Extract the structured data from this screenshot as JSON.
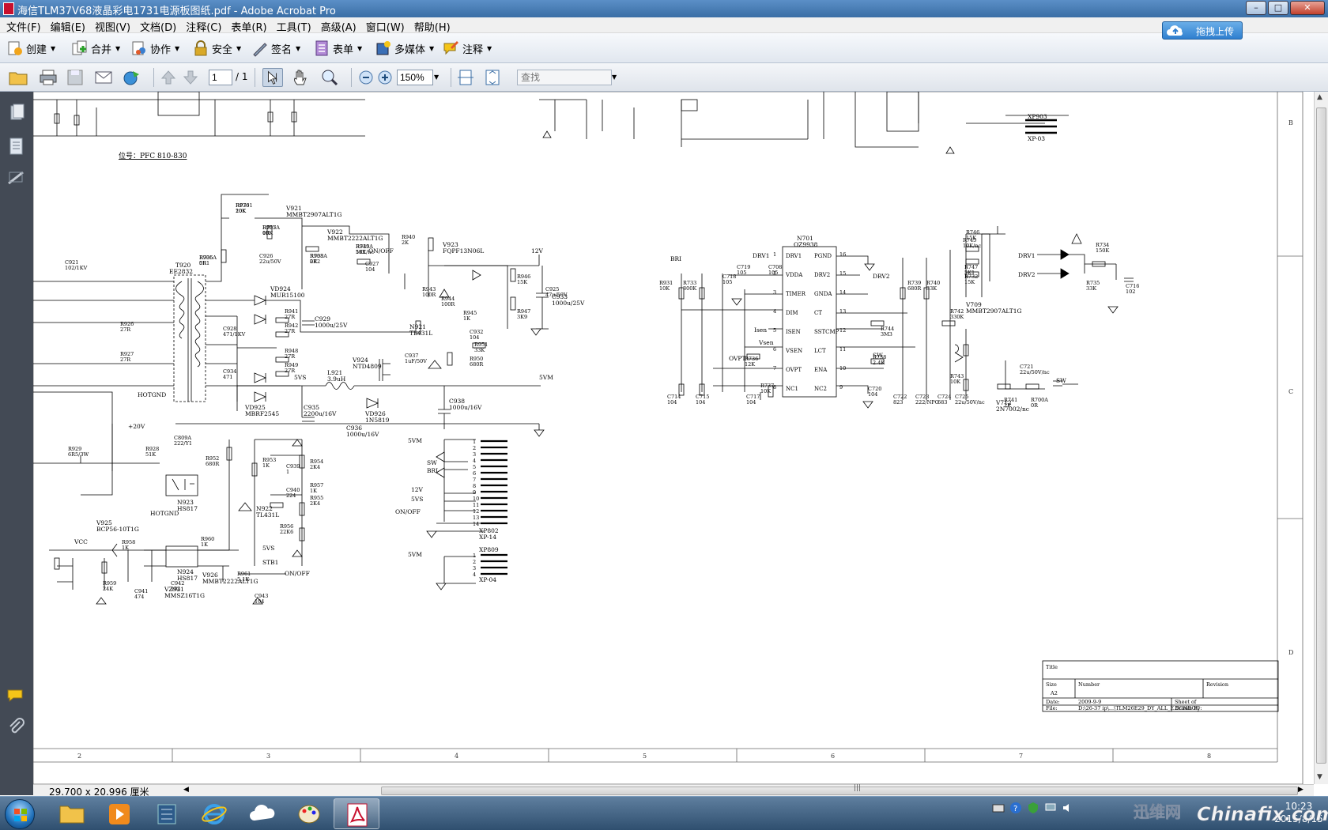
{
  "window": {
    "title": "海信TLM37V68液晶彩电1731电源板图纸.pdf - Adobe Acrobat Pro",
    "buttons": [
      "minimize",
      "maximize",
      "close"
    ]
  },
  "menu": [
    "文件(F)",
    "编辑(E)",
    "视图(V)",
    "文档(D)",
    "注释(C)",
    "表单(R)",
    "工具(T)",
    "高级(A)",
    "窗口(W)",
    "帮助(H)"
  ],
  "upload_button": "拖拽上传",
  "tasks": [
    {
      "label": "创建",
      "icon": "create-icon"
    },
    {
      "label": "合并",
      "icon": "combine-icon"
    },
    {
      "label": "协作",
      "icon": "collaborate-icon"
    },
    {
      "label": "安全",
      "icon": "lock-icon"
    },
    {
      "label": "签名",
      "icon": "pen-icon"
    },
    {
      "label": "表单",
      "icon": "form-icon"
    },
    {
      "label": "多媒体",
      "icon": "multimedia-icon"
    },
    {
      "label": "注释",
      "icon": "comment-icon"
    }
  ],
  "nav": {
    "page_current": "1",
    "page_total": "/ 1",
    "zoom": "150%",
    "find_placeholder": "查找"
  },
  "status": {
    "page_size": "29.700 x 20.996 厘米"
  },
  "clock": {
    "time": "10:23",
    "date": "2015/8/15"
  },
  "watermark": {
    "left": "迅维网",
    "right": "Chinafix.com"
  },
  "schematic": {
    "labels": {
      "position_note": "位号：PFC 810-830",
      "n701": "N701",
      "n701_part": "OZ9938",
      "t920": "T920",
      "t920_part": "EE2832",
      "v921": "V921",
      "v921_part": "MMBT2907ALT1G",
      "v922": "V922",
      "v922_part": "MMBT2222ALT1G",
      "v923": "V923",
      "v923_part": "FQPF13N06L",
      "vd924": "VD924",
      "vd924_part": "MUR15100",
      "vd925": "VD925",
      "vd925_part": "MBRF2545",
      "v924": "V924",
      "v924_part": "NTD4809",
      "vd926": "VD926",
      "vd926_part": "1N5819",
      "l921": "L921",
      "l921_val": "3.9uH",
      "c933": "C933",
      "c933_val": "1000u/25V",
      "c929": "C929",
      "c929_val": "1000u/25V",
      "c935": "C935",
      "c935_val": "2200u/16V",
      "c936": "C936",
      "c936_val": "1000u/16V",
      "c938": "C938",
      "c938_val": "1000u/16V",
      "v925": "V925",
      "v925_part": "BCP56-10T1G",
      "n923": "N923",
      "n923_part": "HS817",
      "n924": "N924",
      "n924_part": "HS817",
      "v926": "V926",
      "v926_part": "MMBT2222ALT1G",
      "vz921": "VZ921",
      "vz921_part": "MMSZ16T1G",
      "n922": "N922",
      "n922_part": "TL431L",
      "n921": "N921",
      "n921_part": "TL431L",
      "v709": "V709",
      "v709_part": "MMBT2907ALT1G",
      "v712": "V712",
      "v712_part": "2N7002/nc",
      "xp802": "XP802",
      "xp802_part": "XP-14",
      "xp809": "XP809",
      "xp809_part": "XP-04",
      "xp903": "XP903",
      "xp903_part": "XP-03",
      "net_12v": "12V",
      "net_5vm": "5VM",
      "net_5vs": "5VS",
      "net_stb1": "STB1",
      "net_onoff": "ON/OFF",
      "net_vcc": "VCC",
      "net_20v": "+20V",
      "net_hotgnd": "HOTGND",
      "net_bri": "BRI",
      "net_sw": "SW",
      "net_vsen": "Vsen",
      "net_isen": "Isen",
      "net_ovpt": "OVPT",
      "net_drv1": "DRV1",
      "net_drv2": "DRV2",
      "title_block_title": "Title",
      "title_block_size": "Size",
      "title_block_size_val": "A2",
      "title_block_number": "Number",
      "title_block_revision": "Revision",
      "title_block_date": "Date:",
      "title_block_date_val": "2009-9-9",
      "title_block_sheet": "Sheet   of",
      "title_block_file": "File:",
      "title_block_file_val": "D:\\26-37 ip\\...\\TLM26E29_DY_ALL_E.SCHDOC",
      "title_block_drawn": "Drawn By:"
    },
    "oz9938_pins_left": [
      "DRV1",
      "VDDA",
      "TIMER",
      "DIM",
      "ISEN",
      "VSEN",
      "OVPT",
      "NC1"
    ],
    "oz9938_pins_right": [
      "PGND",
      "DRV2",
      "GNDA",
      "CT",
      "SSTCMP",
      "LCT",
      "ENA",
      "NC2"
    ],
    "oz9938_pin_nums_left": [
      "1",
      "2",
      "3",
      "4",
      "5",
      "6",
      "7",
      "8"
    ],
    "oz9938_pin_nums_right": [
      "16",
      "15",
      "14",
      "13",
      "12",
      "11",
      "10",
      "9"
    ],
    "border_cols": [
      "2",
      "3",
      "4",
      "5",
      "6",
      "7",
      "8"
    ],
    "border_rows": [
      "B",
      "C",
      "D"
    ],
    "connector_pins_14": [
      "1",
      "2",
      "3",
      "4",
      "5",
      "6",
      "7",
      "8",
      "9",
      "10",
      "11",
      "12",
      "13",
      "14"
    ],
    "connector_pins_4": [
      "1",
      "2",
      "3",
      "4"
    ],
    "xp802_nets": [
      "5VM",
      "SW",
      "BRI",
      "12V",
      "5VS",
      "ON/OFF"
    ],
    "resistors": [
      "R936 20K",
      "R935 5R1",
      "R937 10K",
      "R938 2K2",
      "R939 5K1",
      "R940 2K",
      "R941 27R",
      "R942 27R",
      "R943 100R",
      "R944 100R",
      "R945 1K",
      "R946 15K",
      "R947 3K9",
      "R948 27R",
      "R949 27R",
      "R950 680R",
      "R951 33K",
      "R952 680R",
      "R953 1K",
      "R954 2K4",
      "R955 2K4",
      "R956 22K6",
      "R957 1K",
      "R958 1K",
      "R959 24K",
      "R960 1K",
      "R961 5.1K",
      "R926 27R",
      "R927 27R",
      "R928 51K",
      "R929 6R5/3W",
      "R931 10K",
      "R733 300K",
      "R734 150K",
      "R735 33K",
      "R736 12K",
      "R737 10K",
      "R738 2.4K",
      "R739 680R",
      "R740 33K",
      "R741 2K",
      "R742 330K",
      "R743 10K",
      "R744 3M3",
      "R745 10K/nc",
      "R746 15K",
      "R747 5K1",
      "R732 15K",
      "R700A 0R",
      "RP701 10K",
      "R706A 0R",
      "R705A 0R",
      "R703A 0R",
      "R745A 10K/nc"
    ],
    "capacitors": [
      "C921 102/1KV",
      "C925 47u/50V",
      "C926 22u/50V",
      "C927 104",
      "C928 471/1KV",
      "C932 104",
      "C934 471",
      "C937 1uF/50V",
      "C939 1",
      "C940 224",
      "C941 474",
      "C942 104",
      "C943 104",
      "C809A 222/Y1",
      "C714 104",
      "C715 104",
      "C716 102",
      "C717 104",
      "C718 105",
      "C719 105",
      "C708 105",
      "C720 104",
      "C721 22u/50V/nc",
      "C722 823",
      "C723 222/NPO",
      "C724 683",
      "C725 22u/50V/nc"
    ]
  }
}
